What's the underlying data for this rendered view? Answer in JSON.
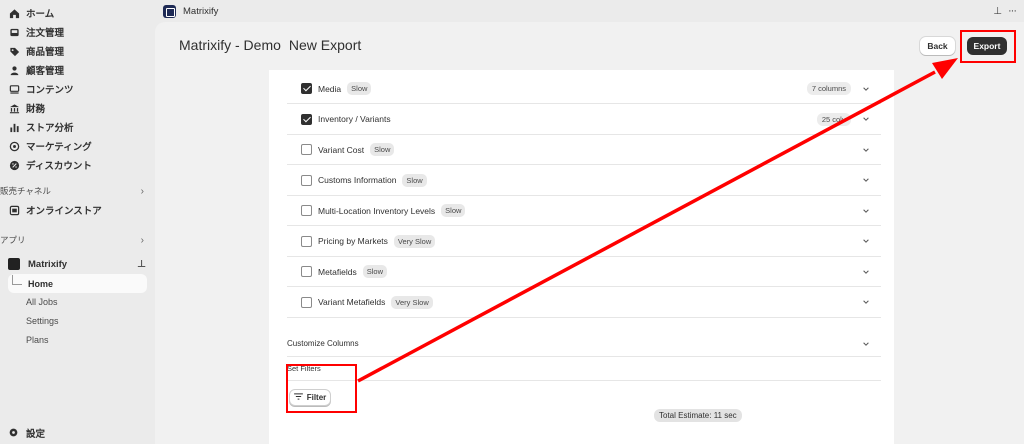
{
  "sidebar": {
    "nav": [
      {
        "label": "ホーム",
        "icon": "home-icon"
      },
      {
        "label": "注文管理",
        "icon": "inbox-icon"
      },
      {
        "label": "商品管理",
        "icon": "tag-icon"
      },
      {
        "label": "顧客管理",
        "icon": "person-icon"
      },
      {
        "label": "コンテンツ",
        "icon": "content-icon"
      },
      {
        "label": "財務",
        "icon": "bank-icon"
      },
      {
        "label": "ストア分析",
        "icon": "analytics-icon"
      },
      {
        "label": "マーケティング",
        "icon": "target-icon"
      },
      {
        "label": "ディスカウント",
        "icon": "discount-icon"
      }
    ],
    "sales_channels_label": "販売チャネル",
    "online_store_label": "オンラインストア",
    "apps_label": "アプリ",
    "app_name": "Matrixify",
    "app_sub": [
      "Home",
      "All Jobs",
      "Settings",
      "Plans"
    ],
    "settings_label": "設定"
  },
  "topbar": {
    "app_title": "Matrixify"
  },
  "header": {
    "breadcrumb": "Matrixify - Demo",
    "title": "New Export",
    "back_label": "Back",
    "export_label": "Export"
  },
  "rows": [
    {
      "label": "Media",
      "tag": "Slow",
      "checked": true,
      "columns": "7 columns"
    },
    {
      "label": "Inventory / Variants",
      "tag": "",
      "checked": true,
      "columns": "25 colu"
    },
    {
      "label": "Variant Cost",
      "tag": "Slow",
      "checked": false,
      "columns": ""
    },
    {
      "label": "Customs Information",
      "tag": "Slow",
      "checked": false,
      "columns": ""
    },
    {
      "label": "Multi-Location Inventory Levels",
      "tag": "Slow",
      "checked": false,
      "columns": ""
    },
    {
      "label": "Pricing by Markets",
      "tag": "Very Slow",
      "checked": false,
      "columns": ""
    },
    {
      "label": "Metafields",
      "tag": "Slow",
      "checked": false,
      "columns": ""
    },
    {
      "label": "Variant Metafields",
      "tag": "Very Slow",
      "checked": false,
      "columns": ""
    }
  ],
  "customize_columns_label": "Customize Columns",
  "set_filters_label": "Set Filters",
  "filter_button_label": "Filter",
  "total_estimate": "Total Estimate: 11 sec",
  "colors": {
    "annotation": "#ff0000",
    "primary_button": "#303030"
  }
}
